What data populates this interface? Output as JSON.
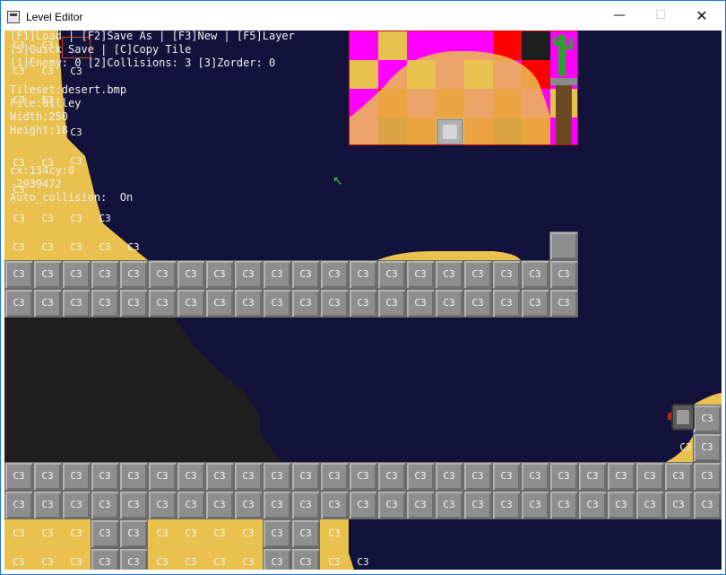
{
  "window": {
    "title": "Level Editor"
  },
  "controls": {
    "minimize": "—",
    "maximize": "☐",
    "close": "✕"
  },
  "hud": {
    "menu_line1": "[F1]Load | [F2]Save As | [F3]New | [F5]Layer",
    "menu_line2": "[S]Quick Save | [C]Copy Tile",
    "layers_line": "[1]Enemy: 0 [2]Collisions: 3 [3]Zorder: 0",
    "tileset": "Tileset:desert.bmp",
    "file": "File:01lley",
    "width": "Width:250",
    "height": "Height:18",
    "coords": "cx:134cy:0",
    "value": "-2939472",
    "auto_collision": "Auto_collision:  On"
  },
  "tile_label": "C3",
  "cursor_icon": "arrow-cursor-icon",
  "colors": {
    "background": "#12123a",
    "stone": "#8e8e8e",
    "sand": "#e9c14e",
    "magenta": "#ff00ff",
    "red": "#ff0000",
    "dark_red": "#8a0000"
  }
}
